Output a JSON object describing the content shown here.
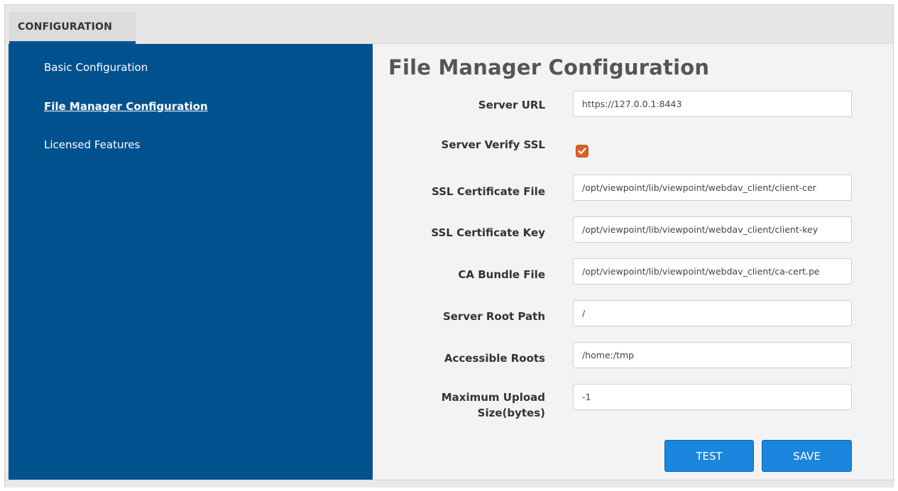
{
  "tabs": [
    {
      "label": "CONFIGURATION",
      "active": true
    }
  ],
  "sidebar": {
    "items": [
      {
        "label": "Basic Configuration",
        "active": false
      },
      {
        "label": "File Manager Configuration",
        "active": true
      },
      {
        "label": "Licensed Features",
        "active": false
      }
    ]
  },
  "main": {
    "title": "File Manager Configuration",
    "fields": {
      "server_url": {
        "label": "Server URL",
        "value": "https://127.0.0.1:8443"
      },
      "server_verify_ssl": {
        "label": "Server Verify SSL",
        "checked": true
      },
      "ssl_cert_file": {
        "label": "SSL Certificate File",
        "value": "/opt/viewpoint/lib/viewpoint/webdav_client/client-cer"
      },
      "ssl_cert_key": {
        "label": "SSL Certificate Key",
        "value": "/opt/viewpoint/lib/viewpoint/webdav_client/client-key"
      },
      "ca_bundle_file": {
        "label": "CA Bundle File",
        "value": "/opt/viewpoint/lib/viewpoint/webdav_client/ca-cert.pe"
      },
      "server_root_path": {
        "label": "Server Root Path",
        "value": "/"
      },
      "accessible_roots": {
        "label": "Accessible Roots",
        "value": "/home:/tmp"
      },
      "max_upload_size": {
        "label_line1": "Maximum Upload",
        "label_line2": "Size(bytes)",
        "value": "-1"
      }
    },
    "buttons": {
      "test_label": "TEST",
      "save_label": "SAVE"
    }
  },
  "colors": {
    "sidebar_bg": "#02518f",
    "button_bg": "#1b86dd",
    "checkbox_accent": "#d9622b"
  },
  "icons": {
    "checkbox": "checkmark-icon"
  }
}
